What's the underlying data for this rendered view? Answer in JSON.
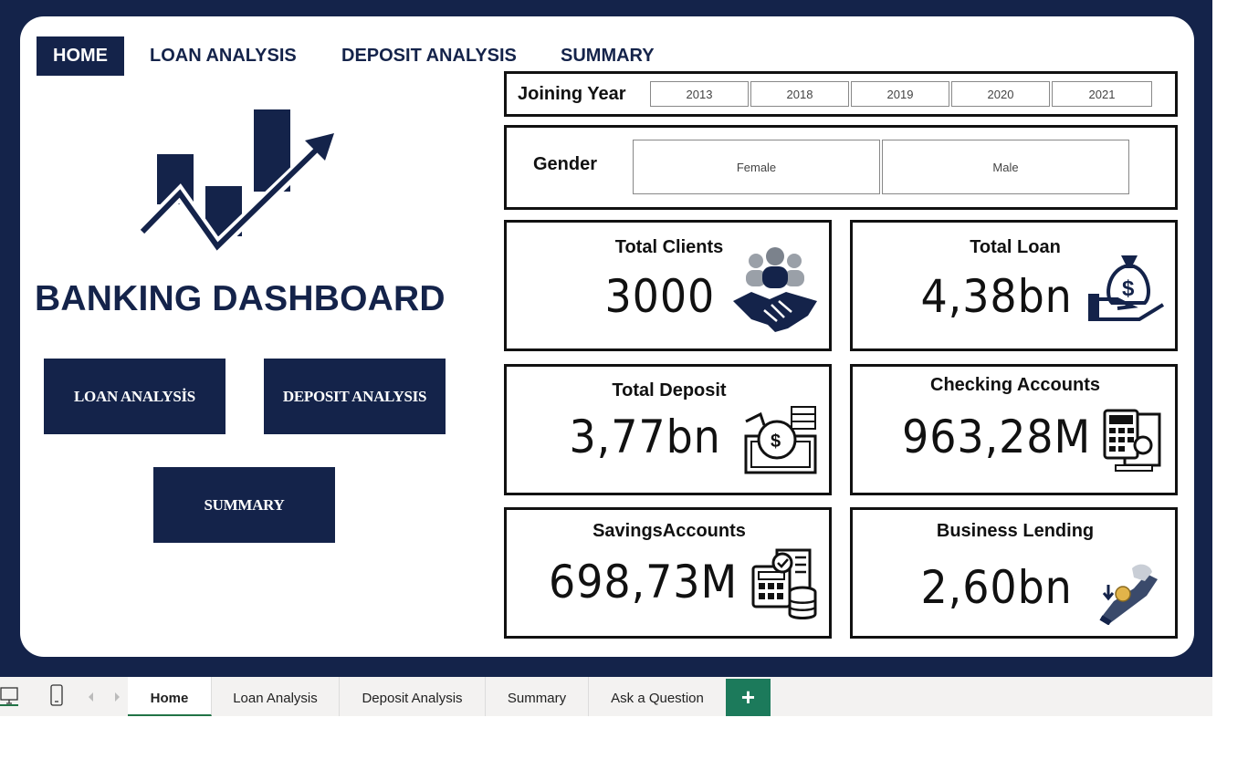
{
  "nav": {
    "items": [
      {
        "label": "HOME",
        "active": true
      },
      {
        "label": "LOAN ANALYSIS",
        "active": false
      },
      {
        "label": "DEPOSIT ANALYSIS",
        "active": false
      },
      {
        "label": "SUMMARY",
        "active": false
      }
    ]
  },
  "dashboard": {
    "title": "BANKING DASHBOARD",
    "buttons": {
      "loan": "LOAN ANALYSİS",
      "deposit": "DEPOSIT ANALYSIS",
      "summary": "SUMMARY"
    }
  },
  "filters": {
    "joining_year": {
      "label": "Joining Year",
      "options": [
        "2013",
        "2018",
        "2019",
        "2020",
        "2021"
      ]
    },
    "gender": {
      "label": "Gender",
      "options": [
        "Female",
        "Male"
      ]
    }
  },
  "kpis": {
    "total_clients": {
      "label": "Total Clients",
      "value": "3000",
      "icon": "handshake-icon"
    },
    "total_loan": {
      "label": "Total Loan",
      "value": "4,38bn",
      "icon": "money-bag-hand-icon"
    },
    "total_deposit": {
      "label": "Total Deposit",
      "value": "3,77bn",
      "icon": "deposit-money-icon"
    },
    "checking_accounts": {
      "label": "Checking Accounts",
      "value": "963,28M",
      "icon": "calculator-invoice-icon"
    },
    "savings_accounts": {
      "label": "SavingsAccounts",
      "value": "698,73M",
      "icon": "calculator-coins-icon"
    },
    "business_lending": {
      "label": "Business Lending",
      "value": "2,60bn",
      "icon": "hand-coin-icon"
    }
  },
  "sheet_tabs": {
    "tabs": [
      "Home",
      "Loan Analysis",
      "Deposit Analysis",
      "Summary",
      "Ask a Question"
    ],
    "active": "Home",
    "add_label": "+"
  },
  "colors": {
    "navy": "#14234a",
    "accent_green": "#1c7a5b"
  }
}
